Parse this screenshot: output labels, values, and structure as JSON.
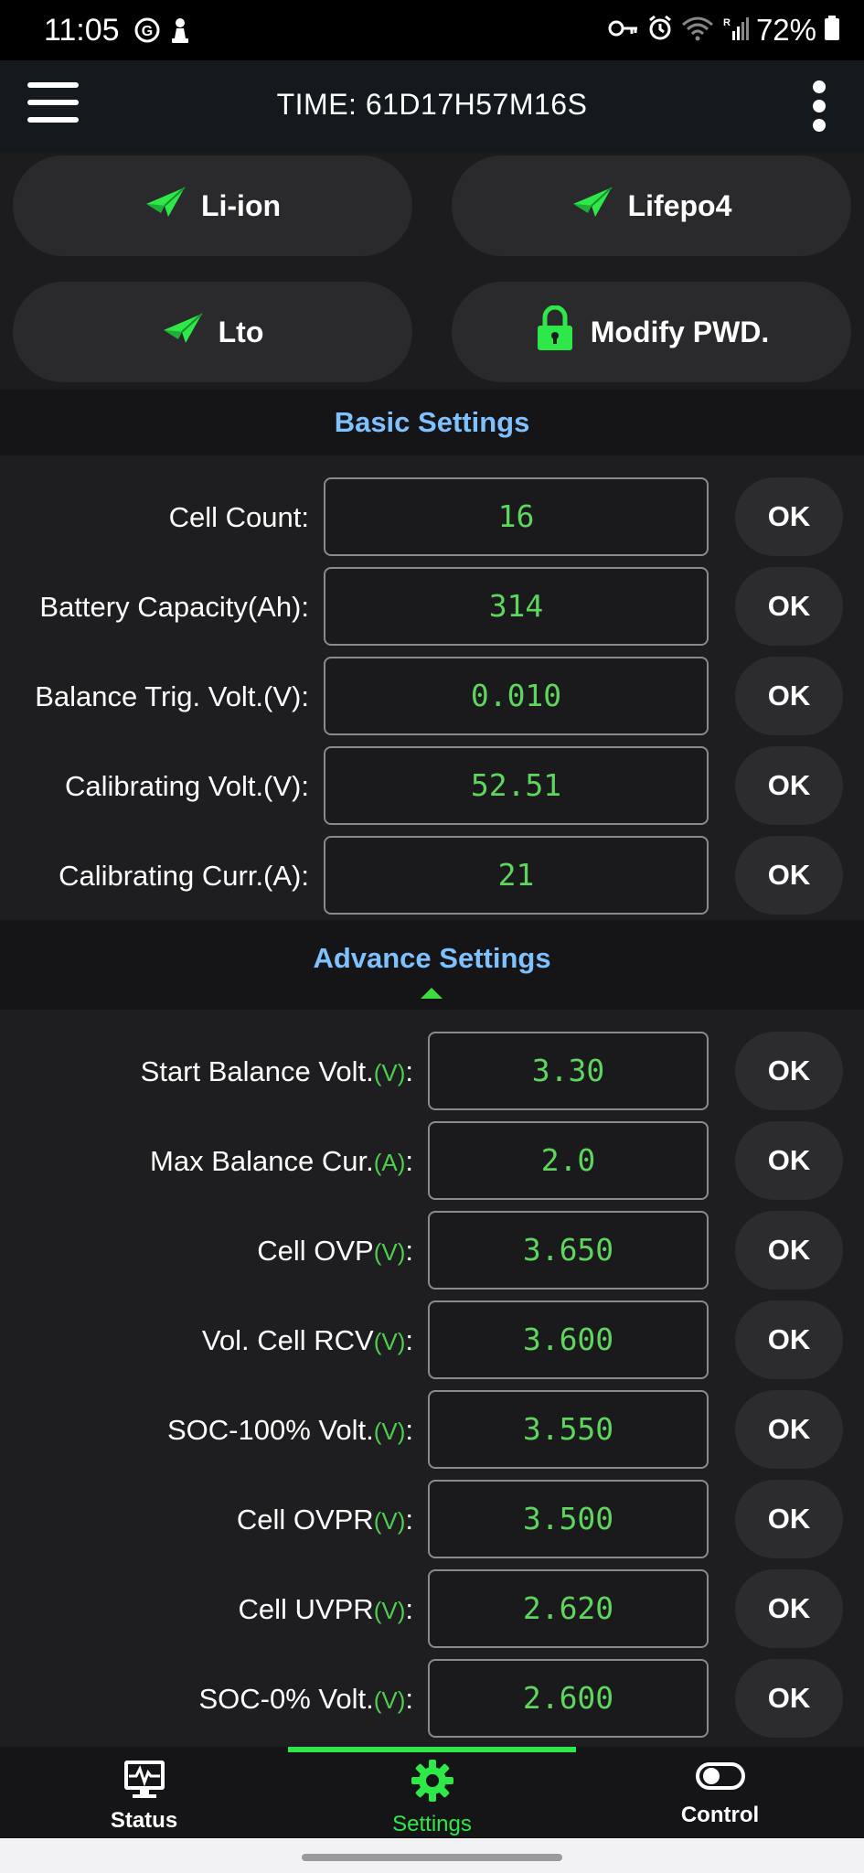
{
  "status_bar": {
    "time": "11:05",
    "battery": "72%"
  },
  "app_bar": {
    "title": "TIME: 61D17H57M16S"
  },
  "presets": [
    {
      "label": "Li-ion"
    },
    {
      "label": "Lifepo4"
    },
    {
      "label": "Lto"
    },
    {
      "label": "Modify PWD."
    }
  ],
  "basic": {
    "title": "Basic Settings",
    "ok_label": "OK",
    "rows": [
      {
        "label": "Cell Count:",
        "value": "16"
      },
      {
        "label": "Battery Capacity(Ah):",
        "value": "314"
      },
      {
        "label": "Balance Trig. Volt.(V):",
        "value": "0.010"
      },
      {
        "label": "Calibrating Volt.(V):",
        "value": "52.51"
      },
      {
        "label": "Calibrating Curr.(A):",
        "value": "21"
      }
    ]
  },
  "advance": {
    "title": "Advance Settings",
    "ok_label": "OK",
    "rows": [
      {
        "label": "Start Balance Volt.",
        "unit": "(V)",
        "colon": ":",
        "value": "3.30"
      },
      {
        "label": "Max Balance Cur.",
        "unit": "(A)",
        "colon": ":",
        "value": "2.0"
      },
      {
        "label": "Cell OVP",
        "unit": "(V)",
        "colon": ":",
        "value": "3.650"
      },
      {
        "label": "Vol. Cell RCV",
        "unit": "(V)",
        "colon": ":",
        "value": "3.600"
      },
      {
        "label": "SOC-100% Volt.",
        "unit": "(V)",
        "colon": ":",
        "value": "3.550"
      },
      {
        "label": "Cell OVPR",
        "unit": "(V)",
        "colon": ":",
        "value": "3.500"
      },
      {
        "label": "Cell UVPR",
        "unit": "(V)",
        "colon": ":",
        "value": "2.620"
      },
      {
        "label": "SOC-0% Volt.",
        "unit": "(V)",
        "colon": ":",
        "value": "2.600"
      }
    ]
  },
  "nav": {
    "items": [
      {
        "label": "Status",
        "icon": "monitor-pulse-icon",
        "active": false
      },
      {
        "label": "Settings",
        "icon": "gear-icon",
        "active": true
      },
      {
        "label": "Control",
        "icon": "toggle-icon",
        "active": false
      }
    ]
  },
  "colors": {
    "accent_green": "#2ee84a",
    "section_title": "#7fc0ff",
    "value_green": "#5ed65e"
  }
}
